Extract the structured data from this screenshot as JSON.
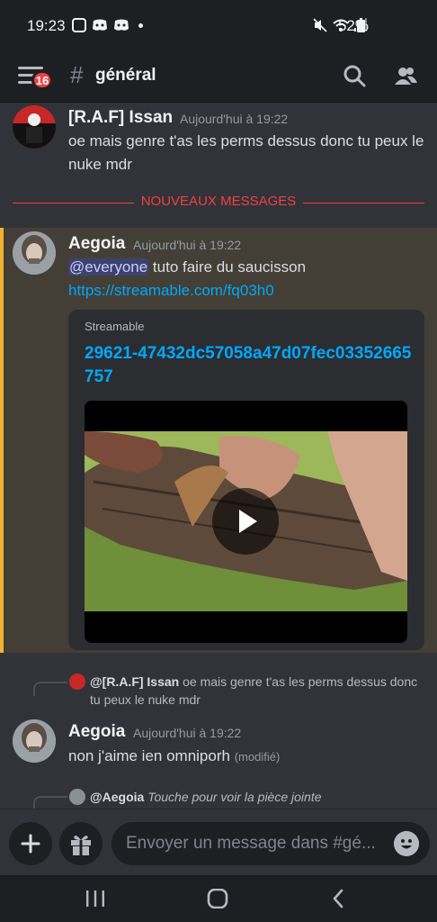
{
  "status": {
    "time": "19:23",
    "battery": "52%"
  },
  "header": {
    "badge": "16",
    "hash": "#",
    "channel": "général"
  },
  "messages": [
    {
      "author": "[R.A.F] Issan",
      "timestamp": "Aujourd'hui à 19:22",
      "text": "oe mais genre t'as les perms dessus donc tu peux le nuke mdr"
    },
    {
      "author": "Aegoia",
      "timestamp": "Aujourd'hui à 19:22",
      "mention": "@everyone",
      "text": " tuto faire du saucisson",
      "link": "https://streamable.com/fq03h0"
    },
    {
      "author": "Aegoia",
      "timestamp": "Aujourd'hui à 19:22",
      "text": "non j'aime ien omniporh",
      "edited": "(modifié)"
    }
  ],
  "divider": "NOUVEAUX MESSAGES",
  "embed": {
    "provider": "Streamable",
    "title": "29621-47432dc57058a47d07fec03352665757"
  },
  "replies": [
    {
      "author": "@[R.A.F] Issan",
      "text": "oe mais genre t'as les perms dessus donc tu peux le nuke mdr"
    },
    {
      "author": "@Aegoia",
      "text": "Touche pour voir la pièce jointe"
    }
  ],
  "composer": {
    "placeholder": "Envoyer un message dans #gé..."
  },
  "colors": {
    "accent_red": "#f23f43",
    "link": "#00a8fc",
    "highlight_bar": "#f0b232",
    "background": "#313338"
  },
  "icons": [
    "menu-icon",
    "search-icon",
    "members-icon",
    "plus-icon",
    "gift-icon",
    "emoji-icon",
    "recent-apps-icon",
    "home-icon",
    "back-icon",
    "play-icon"
  ]
}
